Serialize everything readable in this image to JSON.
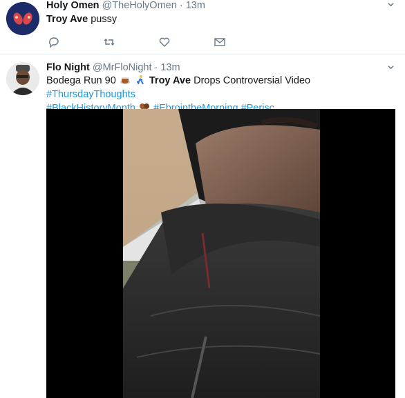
{
  "tweets": [
    {
      "name": "Holy Omen",
      "handle": "@TheHolyOmen",
      "separator": "·",
      "time": "13m",
      "text_bold": "Troy Ave",
      "text_rest": " pussy"
    },
    {
      "name": "Flo Night",
      "handle": "@MrFloNight",
      "separator": "·",
      "time": "13m",
      "text_part1": "Bodega Run 90 ",
      "text_bold": "Troy Ave",
      "text_part2": " Drops Controversial Video ",
      "hashtag1": "#ThursdayThoughts",
      "hashtag2": "#BlackHistoryMonth",
      "hashtag3": "#EbrointheMorning",
      "hashtag4": "#Perisc..."
    }
  ],
  "icons": {
    "reply": "reply-icon",
    "retweet": "retweet-icon",
    "like": "heart-icon",
    "dm": "envelope-icon",
    "menu": "chevron-down-icon"
  },
  "colors": {
    "link": "#1b95e0",
    "muted": "#657786",
    "text": "#14171a"
  }
}
